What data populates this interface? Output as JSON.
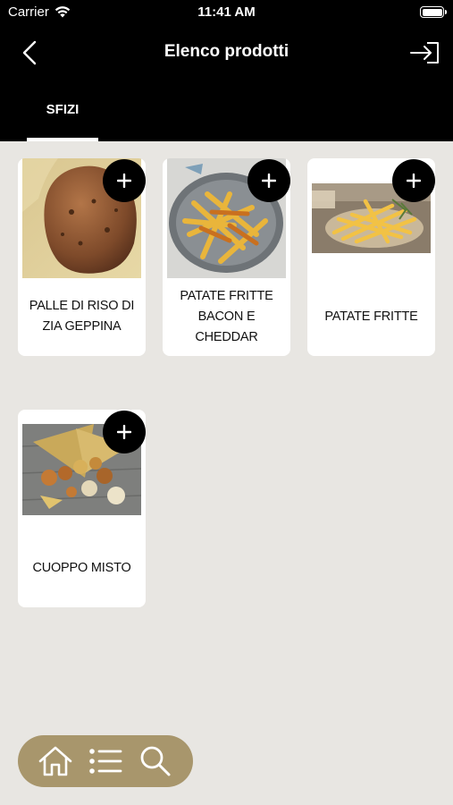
{
  "status_bar": {
    "carrier": "Carrier",
    "time": "11:41 AM"
  },
  "header": {
    "title": "Elenco prodotti"
  },
  "tabs": [
    {
      "label": "SFIZI",
      "active": true
    }
  ],
  "products": [
    {
      "name": "PALLE DI RISO DI ZIA GEPPINA",
      "image": "rice-balls"
    },
    {
      "name": "PATATE FRITTE BACON E CHEDDAR",
      "image": "fries-bacon-cheddar"
    },
    {
      "name": "PATATE FRITTE",
      "image": "french-fries"
    },
    {
      "name": "CUOPPO MISTO",
      "image": "mixed-fried-cone"
    }
  ],
  "icons": {
    "back": "chevron-left-icon",
    "logout": "logout-icon",
    "add": "plus-icon",
    "home": "home-icon",
    "list": "list-icon",
    "search": "search-icon",
    "wifi": "wifi-icon",
    "battery": "battery-icon"
  },
  "colors": {
    "header_bg": "#000000",
    "page_bg": "#e8e6e2",
    "bottom_bar": "#a8966c",
    "card_bg": "#ffffff"
  }
}
